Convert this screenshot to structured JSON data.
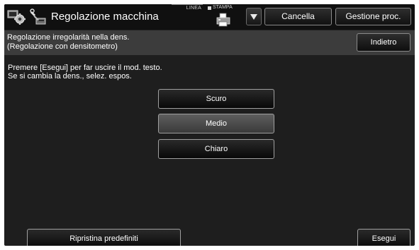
{
  "header": {
    "title": "Regolazione macchina",
    "mode_icon": "settings-mode-icon",
    "tool_icon": "machine-adjust-icon",
    "status_linea_label": "LINEA",
    "status_stampa_label": "STAMPA",
    "printer_icon": "printer-icon",
    "dropdown_icon": "triangle-down-icon",
    "cancel_label": "Cancella",
    "job_status_label": "Gestione proc."
  },
  "subheader": {
    "line1": "Regolazione irregolarità nella dens.",
    "line2": "(Regolazione con densitometro)",
    "back_label": "Indietro"
  },
  "instructions": {
    "line1": "Premere [Esegui] per far uscire il mod. testo.",
    "line2": "Se si cambia la dens., selez. espos."
  },
  "density_options": [
    {
      "label": "Scuro",
      "selected": false
    },
    {
      "label": "Medio",
      "selected": true
    },
    {
      "label": "Chiaro",
      "selected": false
    }
  ],
  "footer": {
    "reset_label": "Ripristina predefiniti",
    "execute_label": "Esegui"
  },
  "colors": {
    "background": "#1e1e1e",
    "subheader": "#3c3c3c",
    "selected_button": "#4e4e4e",
    "text": "#ffffff"
  }
}
